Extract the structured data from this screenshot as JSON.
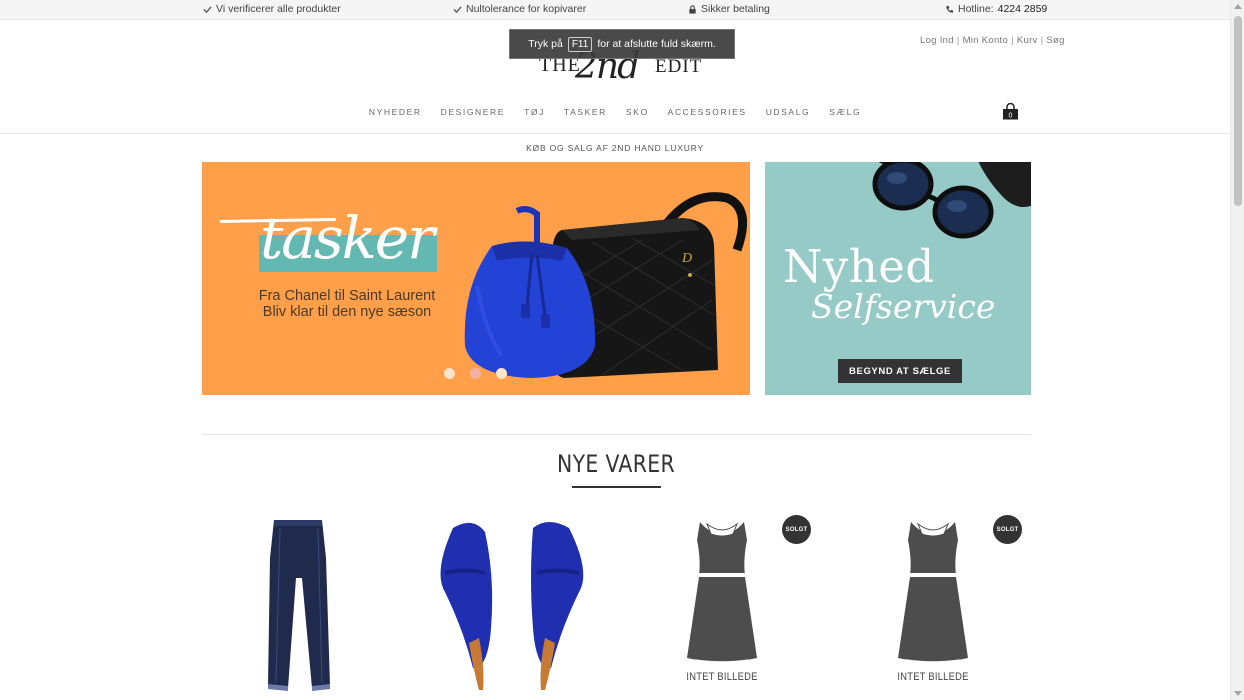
{
  "topbar": {
    "verify": "Vi verificerer alle produkter",
    "tolerance": "Nultolerance for kopivarer",
    "secure": "Sikker betaling",
    "hotline_label": "Hotline:",
    "hotline_number": "4224 2859"
  },
  "fullscreen_notice": {
    "before": "Tryk på",
    "key": "F11",
    "after": "for at afslutte fuld skærm."
  },
  "logo": {
    "the": "THE",
    "script": "2nd",
    "edit": "EDIT"
  },
  "account_links": [
    "Log Ind",
    "Min Konto",
    "Kurv",
    "Søg"
  ],
  "nav": [
    "NYHEDER",
    "DESIGNERE",
    "TØJ",
    "TASKER",
    "SKO",
    "ACCESSORIES",
    "UDSALG",
    "SÆLG"
  ],
  "cart": {
    "count": "0"
  },
  "tagline": "KØB OG SALG AF 2ND HAND LUXURY",
  "hero_main": {
    "script_word": "tasker",
    "line1": "Fra Chanel til Saint Laurent",
    "line2": "Bliv klar til den nye sæson",
    "slide_count": 3,
    "active_slide": 2
  },
  "hero_side": {
    "title": "Nyhed",
    "subtitle": "Selfservice",
    "button": "BEGYND AT SÆLGE"
  },
  "section": {
    "title": "NYE VARER"
  },
  "products": [
    {
      "image": "jeans",
      "sold": false
    },
    {
      "image": "blue-heels",
      "sold": false
    },
    {
      "image": "no-image-dress",
      "sold": true,
      "badge": "SOLGT",
      "no_image_label": "INTET BILLEDE"
    },
    {
      "image": "no-image-dress",
      "sold": true,
      "badge": "SOLGT",
      "no_image_label": "INTET BILLEDE"
    }
  ],
  "colors": {
    "hero_orange": "#ff9f4a",
    "hero_teal": "#95cac6",
    "accent_teal": "#63b8b1",
    "dark": "#333333"
  }
}
